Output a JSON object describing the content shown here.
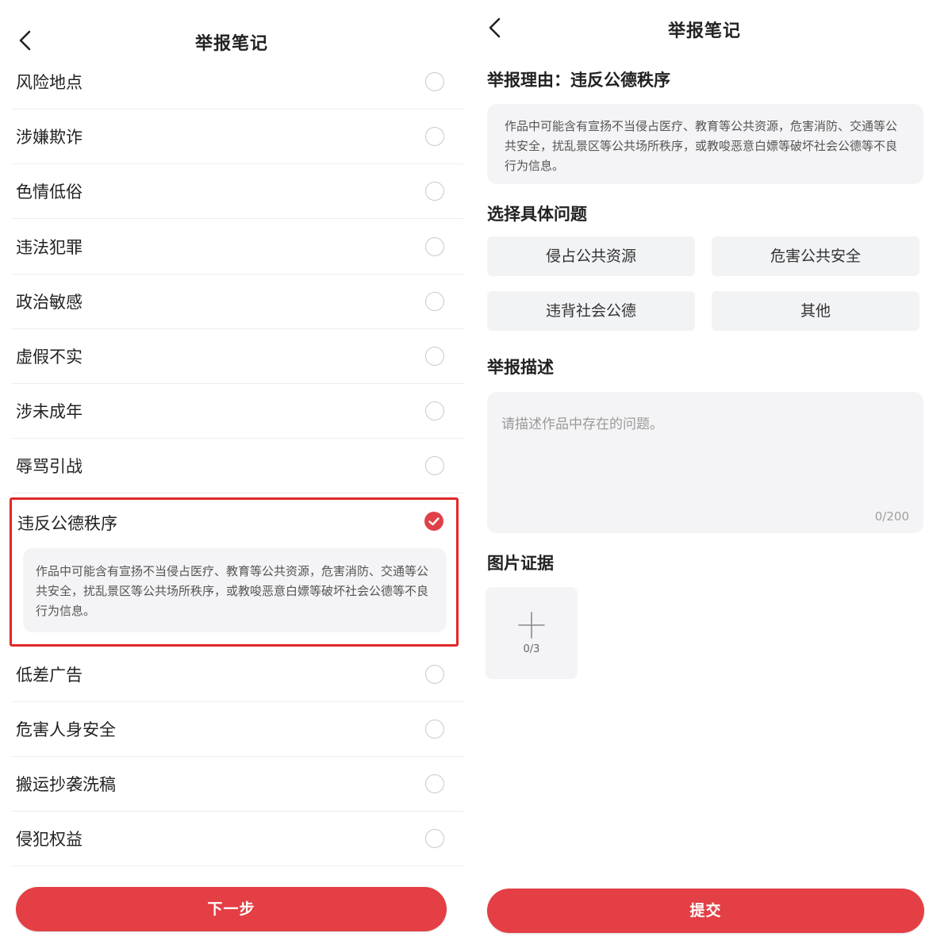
{
  "left": {
    "title": "举报笔记",
    "reasons": [
      {
        "label": "风险地点",
        "checked": false
      },
      {
        "label": "涉嫌欺诈",
        "checked": false
      },
      {
        "label": "色情低俗",
        "checked": false
      },
      {
        "label": "违法犯罪",
        "checked": false
      },
      {
        "label": "政治敏感",
        "checked": false
      },
      {
        "label": "虚假不实",
        "checked": false
      },
      {
        "label": "涉未成年",
        "checked": false
      },
      {
        "label": "辱骂引战",
        "checked": false
      },
      {
        "label": "违反公德秩序",
        "checked": true
      },
      {
        "label": "低差广告",
        "checked": false
      },
      {
        "label": "危害人身安全",
        "checked": false
      },
      {
        "label": "搬运抄袭洗稿",
        "checked": false
      },
      {
        "label": "侵犯权益",
        "checked": false
      }
    ],
    "selected_description": "作品中可能含有宣扬不当侵占医疗、教育等公共资源，危害消防、交通等公共安全，扰乱景区等公共场所秩序，或教唆恶意白嫖等破坏社会公德等不良行为信息。",
    "next_label": "下一步"
  },
  "right": {
    "title": "举报笔记",
    "reason_line": "举报理由：违反公德秩序",
    "reason_description": "作品中可能含有宣扬不当侵占医疗、教育等公共资源，危害消防、交通等公共安全，扰乱景区等公共场所秩序，或教唆恶意白嫖等破坏社会公德等不良行为信息。",
    "issues_title": "选择具体问题",
    "issues": [
      "侵占公共资源",
      "危害公共安全",
      "违背社会公德",
      "其他"
    ],
    "description_title": "举报描述",
    "description_placeholder": "请描述作品中存在的问题。",
    "description_counter": "0/200",
    "evidence_title": "图片证据",
    "evidence_counter": "0/3",
    "submit_label": "提交"
  },
  "colors": {
    "accent": "#e33f45",
    "highlight_border": "#e02828",
    "card_bg": "#f4f4f6"
  },
  "icons": {
    "back": "chevron-left-icon",
    "radio_checked": "check-circle-icon",
    "upload": "plus-icon"
  }
}
